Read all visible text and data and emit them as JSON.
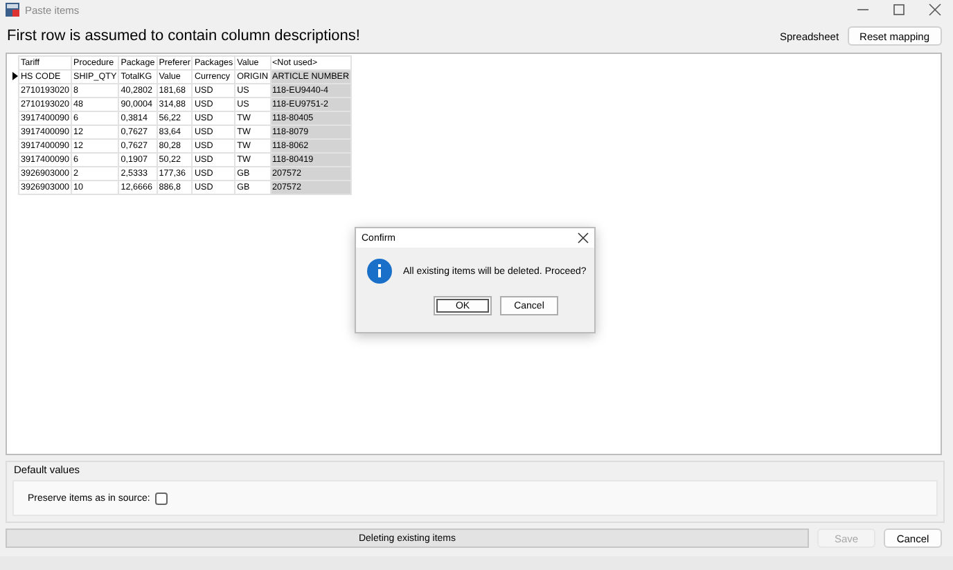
{
  "window": {
    "title": "Paste items"
  },
  "header": {
    "message": "First row is assumed to contain column descriptions!",
    "mode_label": "Spreadsheet",
    "reset_button": "Reset mapping"
  },
  "grid": {
    "columns": [
      {
        "mapping": "Tariff",
        "selected": false
      },
      {
        "mapping": "Procedure",
        "selected": false
      },
      {
        "mapping": "Package",
        "selected": false
      },
      {
        "mapping": "Preferer",
        "selected": false
      },
      {
        "mapping": "Packages",
        "selected": false
      },
      {
        "mapping": "Value",
        "selected": false
      },
      {
        "mapping": "<Not used>",
        "selected": true
      }
    ],
    "rows": [
      {
        "current": true,
        "cells": [
          "HS CODE",
          "SHIP_QTY",
          "TotalKG",
          "Value",
          "Currency",
          "ORIGIN",
          "ARTICLE NUMBER"
        ]
      },
      {
        "current": false,
        "cells": [
          "2710193020",
          "8",
          "40,2802",
          "181,68",
          "USD",
          "US",
          "118-EU9440-4"
        ]
      },
      {
        "current": false,
        "cells": [
          "2710193020",
          "48",
          "90,0004",
          "314,88",
          "USD",
          "US",
          "118-EU9751-2"
        ]
      },
      {
        "current": false,
        "cells": [
          "3917400090",
          "6",
          "0,3814",
          "56,22",
          "USD",
          "TW",
          "118-80405"
        ]
      },
      {
        "current": false,
        "cells": [
          "3917400090",
          "12",
          "0,7627",
          "83,64",
          "USD",
          "TW",
          "118-8079"
        ]
      },
      {
        "current": false,
        "cells": [
          "3917400090",
          "12",
          "0,7627",
          "80,28",
          "USD",
          "TW",
          "118-8062"
        ]
      },
      {
        "current": false,
        "cells": [
          "3917400090",
          "6",
          "0,1907",
          "50,22",
          "USD",
          "TW",
          "118-80419"
        ]
      },
      {
        "current": false,
        "cells": [
          "3926903000",
          "2",
          "2,5333",
          "177,36",
          "USD",
          "GB",
          "207572"
        ]
      },
      {
        "current": false,
        "cells": [
          "3926903000",
          "10",
          "12,6666",
          "886,8",
          "USD",
          "GB",
          "207572"
        ]
      }
    ]
  },
  "default_values": {
    "title": "Default values",
    "preserve_label": "Preserve items as in source:",
    "preserve_checked": false
  },
  "status": {
    "text": "Deleting existing items",
    "save_button": "Save",
    "save_disabled": true,
    "cancel_button": "Cancel"
  },
  "dialog": {
    "title": "Confirm",
    "message": "All existing items will be deleted. Proceed?",
    "ok_button": "OK",
    "cancel_button": "Cancel"
  }
}
